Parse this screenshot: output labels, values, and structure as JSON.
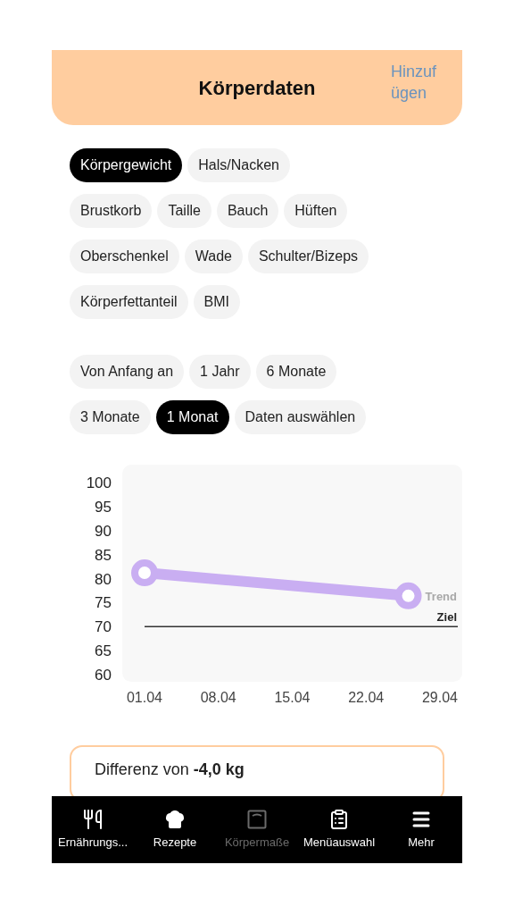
{
  "header": {
    "title": "Körperdaten",
    "action": "Hinzufügen"
  },
  "measures": [
    [
      {
        "label": "Körpergewicht",
        "selected": true
      },
      {
        "label": "Hals/Nacken",
        "selected": false
      }
    ],
    [
      {
        "label": "Brustkorb",
        "selected": false
      },
      {
        "label": "Taille",
        "selected": false
      },
      {
        "label": "Bauch",
        "selected": false
      },
      {
        "label": "Hüften",
        "selected": false
      }
    ],
    [
      {
        "label": "Oberschenkel",
        "selected": false
      },
      {
        "label": "Wade",
        "selected": false
      },
      {
        "label": "Schulter/Bizeps",
        "selected": false
      }
    ],
    [
      {
        "label": "Körperfettanteil",
        "selected": false
      },
      {
        "label": "BMI",
        "selected": false
      }
    ]
  ],
  "periods": [
    [
      {
        "label": "Von Anfang an",
        "selected": false
      },
      {
        "label": "1 Jahr",
        "selected": false
      },
      {
        "label": "6 Monate",
        "selected": false
      }
    ],
    [
      {
        "label": "3 Monate",
        "selected": false
      },
      {
        "label": "1 Monat",
        "selected": true
      },
      {
        "label": "Daten auswählen",
        "selected": false
      }
    ]
  ],
  "chart_data": {
    "type": "line",
    "x": [
      1.04,
      26.04
    ],
    "series": [
      {
        "name": "Trend",
        "color": "#c9aef2",
        "values": [
          81.2,
          76.4
        ],
        "marker": "circle"
      }
    ],
    "xlim": [
      -1.07,
      31.16
    ],
    "ylim": [
      58.5,
      103.7
    ],
    "xticks": [
      {
        "value": 1.04,
        "label": "01.04"
      },
      {
        "value": 8.04,
        "label": "08.04"
      },
      {
        "value": 15.04,
        "label": "15.04"
      },
      {
        "value": 22.04,
        "label": "22.04"
      },
      {
        "value": 29.04,
        "label": "29.04"
      }
    ],
    "yticks": [
      100,
      95,
      90,
      85,
      80,
      75,
      70,
      65,
      60
    ],
    "ref_lines": [
      {
        "axis": "y",
        "value": 70,
        "label": "Ziel"
      }
    ]
  },
  "summary": {
    "text": "Differenz von **-4,0 kg**"
  },
  "nav": [
    {
      "label": "Ernährungs...",
      "kind": "utensils",
      "selected": false
    },
    {
      "label": "Rezepte",
      "kind": "chef",
      "selected": false
    },
    {
      "label": "Körpermaße",
      "kind": "scale",
      "selected": true
    },
    {
      "label": "Menüauswahl",
      "kind": "clipboard",
      "selected": false
    },
    {
      "label": "Mehr",
      "kind": "menu",
      "selected": false
    }
  ]
}
